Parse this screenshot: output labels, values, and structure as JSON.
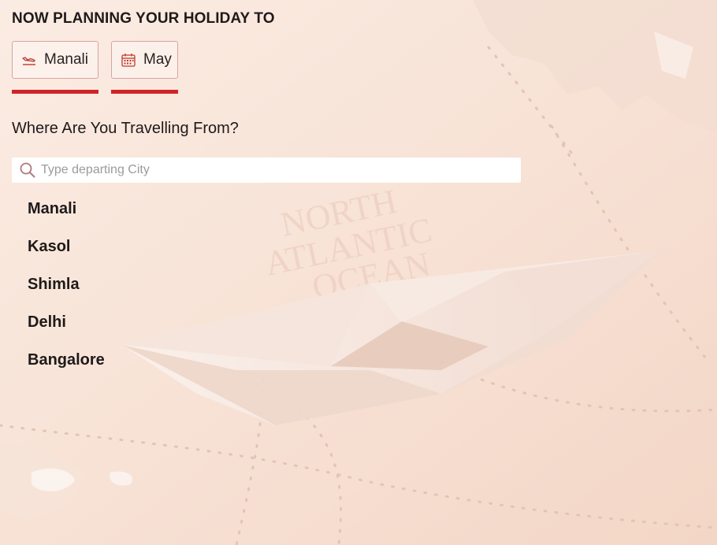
{
  "header": {
    "title": "NOW PLANNING YOUR HOLIDAY TO"
  },
  "chips": {
    "destination": {
      "label": "Manali",
      "icon": "plane-landing-icon"
    },
    "month": {
      "label": "May",
      "icon": "calendar-icon"
    }
  },
  "origin": {
    "question": "Where Are You Travelling From?",
    "placeholder": "Type departing City",
    "value": "",
    "cities": [
      "Manali",
      "Kasol",
      "Shimla",
      "Delhi",
      "Bangalore"
    ]
  },
  "colors": {
    "accent": "#d0232a",
    "background": "#f9e6da",
    "chip_border": "#d9a3a3"
  }
}
